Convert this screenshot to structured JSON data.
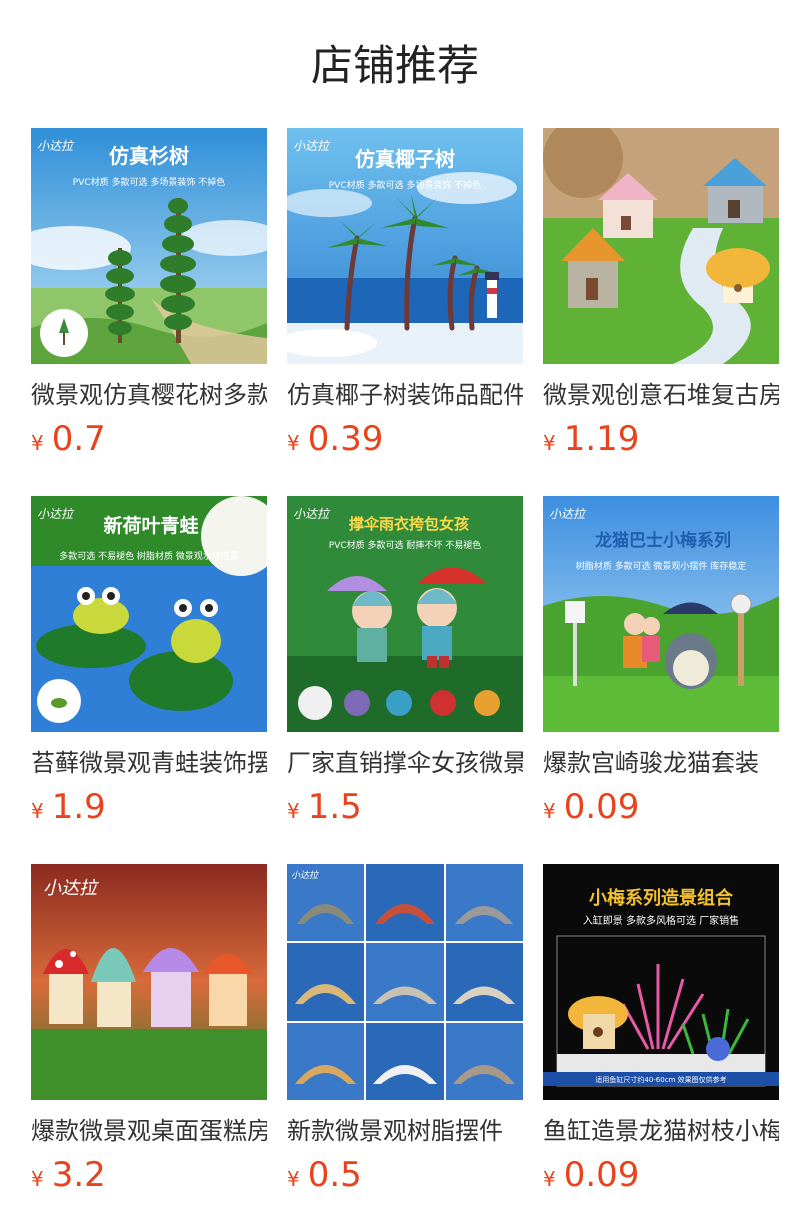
{
  "section_title": "店铺推荐",
  "currency_symbol": "¥",
  "products": [
    {
      "name": "微景观仿真樱花树多款",
      "price": "0.7",
      "image": {
        "logo": "小达拉",
        "headline": "仿真杉树",
        "subline": "PVC材质 多款可选 多场景装饰 不掉色"
      }
    },
    {
      "name": "仿真椰子树装饰品配件",
      "price": "0.39",
      "image": {
        "logo": "小达拉",
        "headline": "仿真椰子树",
        "subline": "PVC材质 多款可选 多场景装饰 不掉色"
      }
    },
    {
      "name": "微景观创意石堆复古房子",
      "price": "1.19",
      "image": {}
    },
    {
      "name": "苔藓微景观青蛙装饰摆件",
      "price": "1.9",
      "image": {
        "logo": "小达拉",
        "headline": "新荷叶青蛙",
        "subline": "多款可选 不易褪色 树脂材质 微景观水族造景"
      }
    },
    {
      "name": "厂家直销撑伞女孩微景观",
      "price": "1.5",
      "image": {
        "logo": "小达拉",
        "headline": "撑伞雨衣挎包女孩",
        "subline": "PVC材质 多款可选 耐摔不坏 不易褪色"
      }
    },
    {
      "name": "爆款宫崎骏龙猫套装",
      "price": "0.09",
      "image": {
        "logo": "小达拉",
        "headline": "龙猫巴士小梅系列",
        "subline": "树脂材质 多款可选 微景观小摆件 库存稳定"
      }
    },
    {
      "name": "爆款微景观桌面蛋糕房子",
      "price": "3.2",
      "image": {
        "logo": "小达拉"
      }
    },
    {
      "name": "新款微景观树脂摆件",
      "price": "0.5",
      "image": {
        "logo": "小达拉"
      }
    },
    {
      "name": "鱼缸造景龙猫树枝小梅",
      "price": "0.09",
      "image": {
        "headline": "小梅系列造景组合",
        "subline": "入缸即景 多款多风格可选 厂家销售",
        "footer": "适用鱼缸尺寸约40-60cm 效果图仅供参考"
      }
    }
  ]
}
